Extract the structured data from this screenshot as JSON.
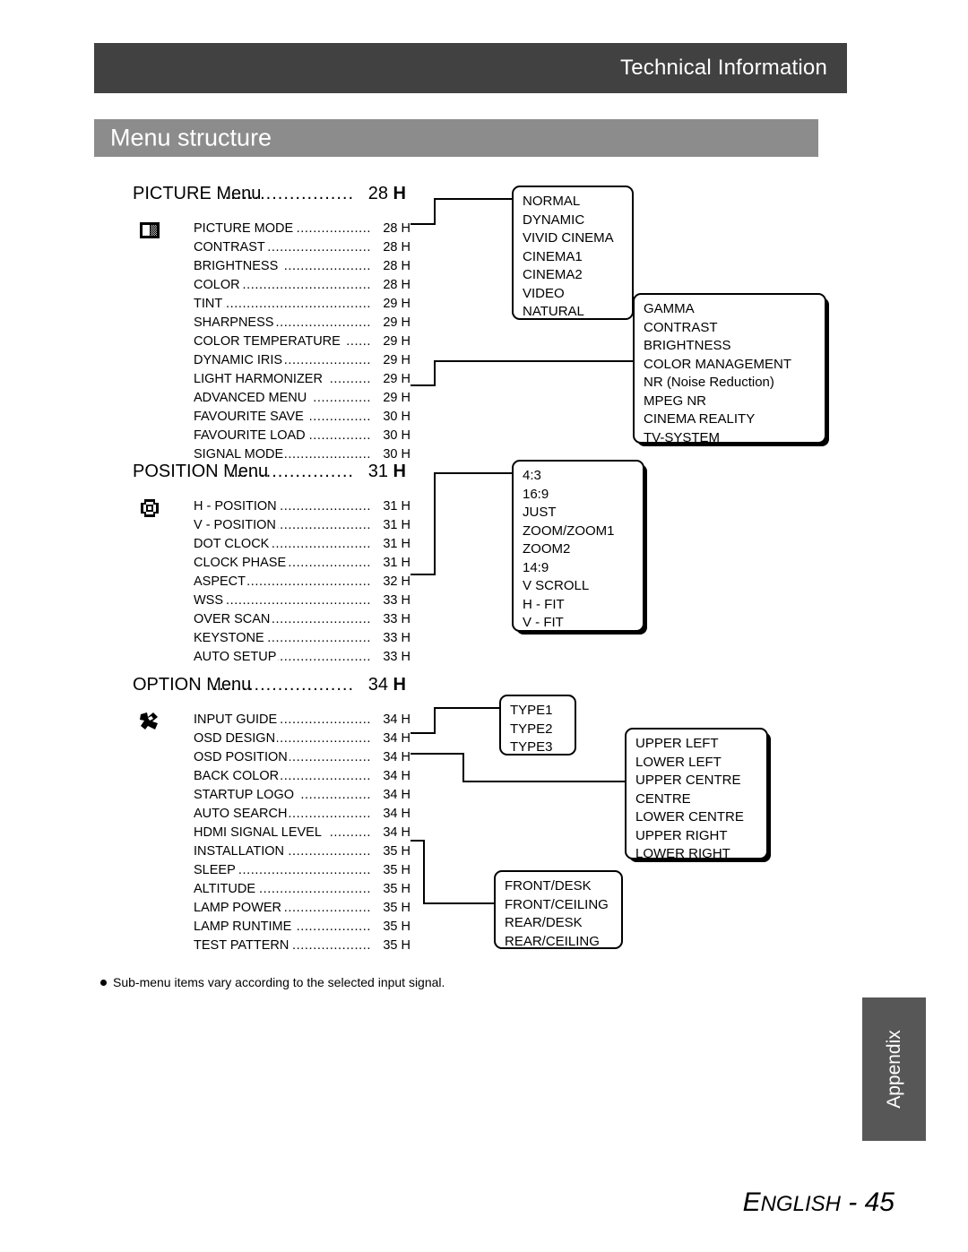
{
  "header": {
    "title": "Technical Information",
    "section_title": "Menu structure",
    "dark_bar_color": "#414141",
    "section_bar_color": "#8c8c8c"
  },
  "menus": [
    {
      "id": "picture",
      "heading": "PICTURE Menu",
      "heading_dots": "......................",
      "heading_page": "28",
      "heading_unit": "H",
      "icon": "picture-mode-icon",
      "items": [
        {
          "label": "PICTURE MODE",
          "dots": "...................",
          "page": "28 H"
        },
        {
          "label": "CONTRAST",
          "dots": "..........................",
          "page": "28 H"
        },
        {
          "label": "BRIGHTNESS",
          "dots": ".....................",
          "page": "28 H"
        },
        {
          "label": "COLOR",
          "dots": "..................................",
          "page": "28 H"
        },
        {
          "label": "TINT",
          "dots": "......................................",
          "page": "29 H"
        },
        {
          "label": "SHARPNESS",
          "dots": ".......................",
          "page": "29 H"
        },
        {
          "label": "COLOR TEMPERATURE",
          "dots": "......",
          "page": "29 H"
        },
        {
          "label": "DYNAMIC IRIS",
          "dots": ".....................",
          "page": "29 H"
        },
        {
          "label": "LIGHT HARMONIZER",
          "dots": "..........",
          "page": "29 H"
        },
        {
          "label": "ADVANCED MENU",
          "dots": "..............",
          "page": "29 H"
        },
        {
          "label": "FAVOURITE SAVE",
          "dots": "...............",
          "page": "30 H"
        },
        {
          "label": "FAVOURITE LOAD",
          "dots": "...............",
          "page": "30 H"
        },
        {
          "label": "SIGNAL MODE",
          "dots": ".....................",
          "page": "30 H"
        }
      ]
    },
    {
      "id": "position",
      "heading": "POSITION Menu",
      "heading_dots": ".....................",
      "heading_page": "31",
      "heading_unit": "H",
      "icon": "position-frame-icon",
      "items": [
        {
          "label": "H - POSITION",
          "dots": ".......................",
          "page": "31 H"
        },
        {
          "label": "V - POSITION",
          "dots": ".......................",
          "page": "31 H"
        },
        {
          "label": "DOT CLOCK",
          "dots": ".........................",
          "page": "31 H"
        },
        {
          "label": "CLOCK PHASE",
          "dots": "....................",
          "page": "31 H"
        },
        {
          "label": "ASPECT",
          "dots": "................................",
          "page": "32 H"
        },
        {
          "label": "WSS",
          "dots": "......................................",
          "page": "33 H"
        },
        {
          "label": "OVER SCAN",
          "dots": "........................",
          "page": "33 H"
        },
        {
          "label": "KEYSTONE",
          "dots": "..........................",
          "page": "33 H"
        },
        {
          "label": "AUTO SETUP",
          "dots": ".......................",
          "page": "33 H"
        }
      ]
    },
    {
      "id": "option",
      "heading": "OPTION Menu",
      "heading_dots": "........................",
      "heading_page": "34",
      "heading_unit": "H",
      "icon": "option-tool-icon",
      "items": [
        {
          "label": "INPUT GUIDE",
          "dots": "......................",
          "page": "34 H"
        },
        {
          "label": "OSD DESIGN",
          "dots": "........................",
          "page": "34 H"
        },
        {
          "label": "OSD POSITION",
          "dots": ".....................",
          "page": "34 H"
        },
        {
          "label": "BACK COLOR",
          "dots": "......................",
          "page": "34 H"
        },
        {
          "label": "STARTUP LOGO",
          "dots": ".................",
          "page": "34 H"
        },
        {
          "label": "AUTO SEARCH",
          "dots": "....................",
          "page": "34 H"
        },
        {
          "label": "HDMI SIGNAL LEVEL",
          "dots": "..........",
          "page": "34 H"
        },
        {
          "label": "INSTALLATION",
          "dots": "....................",
          "page": "35 H"
        },
        {
          "label": "SLEEP",
          "dots": "..................................",
          "page": "35 H"
        },
        {
          "label": "ALTITUDE",
          "dots": "............................",
          "page": "35 H"
        },
        {
          "label": "LAMP POWER",
          "dots": "......................",
          "page": "35 H"
        },
        {
          "label": "LAMP RUNTIME",
          "dots": "..................",
          "page": "35 H"
        },
        {
          "label": "TEST PATTERN",
          "dots": "...................",
          "page": "35 H"
        }
      ]
    }
  ],
  "callouts": [
    {
      "id": "picture-mode-options",
      "source": "PICTURE MODE",
      "shadowed": false,
      "lines": [
        "NORMAL",
        "DYNAMIC",
        "VIVID CINEMA",
        "CINEMA1",
        "CINEMA2",
        "VIDEO",
        "NATURAL"
      ]
    },
    {
      "id": "advanced-menu-options",
      "source": "ADVANCED MENU",
      "shadowed": true,
      "lines": [
        "GAMMA",
        "CONTRAST",
        "BRIGHTNESS",
        "COLOR MANAGEMENT",
        "NR (Noise Reduction)",
        "MPEG NR",
        "CINEMA REALITY",
        "TV-SYSTEM"
      ]
    },
    {
      "id": "aspect-options",
      "source": "ASPECT",
      "shadowed": true,
      "lines": [
        "4:3",
        "16:9",
        "JUST",
        "ZOOM/ZOOM1",
        "ZOOM2",
        "14:9",
        "V SCROLL",
        "H - FIT",
        "V - FIT"
      ]
    },
    {
      "id": "osd-design-options",
      "source": "OSD DESIGN",
      "shadowed": false,
      "lines": [
        "TYPE1",
        "TYPE2",
        "TYPE3"
      ]
    },
    {
      "id": "osd-position-options",
      "source": "OSD POSITION",
      "shadowed": true,
      "lines": [
        "UPPER LEFT",
        "LOWER LEFT",
        "UPPER CENTRE",
        "CENTRE",
        "LOWER CENTRE",
        "UPPER RIGHT",
        "LOWER RIGHT"
      ]
    },
    {
      "id": "installation-options",
      "source": "INSTALLATION",
      "shadowed": false,
      "lines": [
        "FRONT/DESK",
        "FRONT/CEILING",
        "REAR/DESK",
        "REAR/CEILING"
      ]
    }
  ],
  "footnote": "Sub-menu items vary according to the selected input signal.",
  "footer": {
    "tab_label": "Appendix",
    "language_first": "E",
    "language_rest": "NGLISH",
    "separator": " - ",
    "page_number": "45"
  }
}
